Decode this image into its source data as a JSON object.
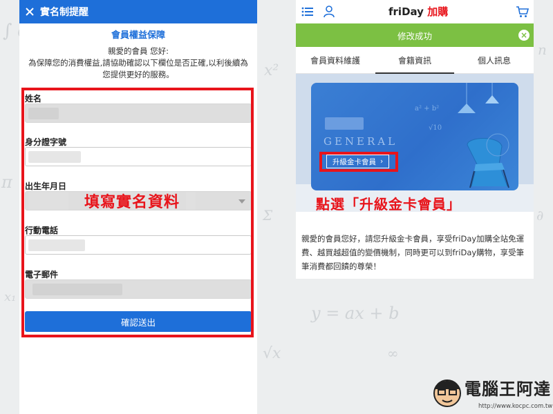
{
  "left": {
    "header_title": "實名制提醒",
    "notice_title": "會員權益保障",
    "greeting": "親愛的會員 您好:",
    "notice_body": "為保障您的消費權益,請協助確認以下欄位是否正確,以利後續為您提供更好的服務。",
    "fields": {
      "name": "姓名",
      "id_number": "身分證字號",
      "birthday": "出生年月日",
      "mobile": "行動電話",
      "email": "電子郵件"
    },
    "submit_label": "確認送出",
    "annotation": "填寫實名資料"
  },
  "right": {
    "logo_text": "friDay",
    "logo_suffix": "加購",
    "success_text": "修改成功",
    "tabs": [
      "會員資料維護",
      "會籍資訊",
      "個人訊息"
    ],
    "active_tab": "會籍資訊",
    "card_tier": "GENERAL",
    "upgrade_label": "升級金卡會員",
    "annotation": "點選「升級金卡會員」",
    "description": "親愛的會員您好，請您升級金卡會員，享受friDay加購全站免運費、越買越超值的變價機制，同時更可以到friDay購物，享受筆筆消費都回饋的尊榮！"
  },
  "watermark": {
    "name": "電腦王阿達",
    "url": "http://www.kocpc.com.tw"
  },
  "colors": {
    "primary_blue": "#1e6fd9",
    "annotation_red": "#e8141b",
    "success_green": "#7cc043"
  },
  "icons": [
    "close-icon",
    "menu-icon",
    "user-icon",
    "cart-icon",
    "chevron-right-icon",
    "chevron-down-icon"
  ]
}
